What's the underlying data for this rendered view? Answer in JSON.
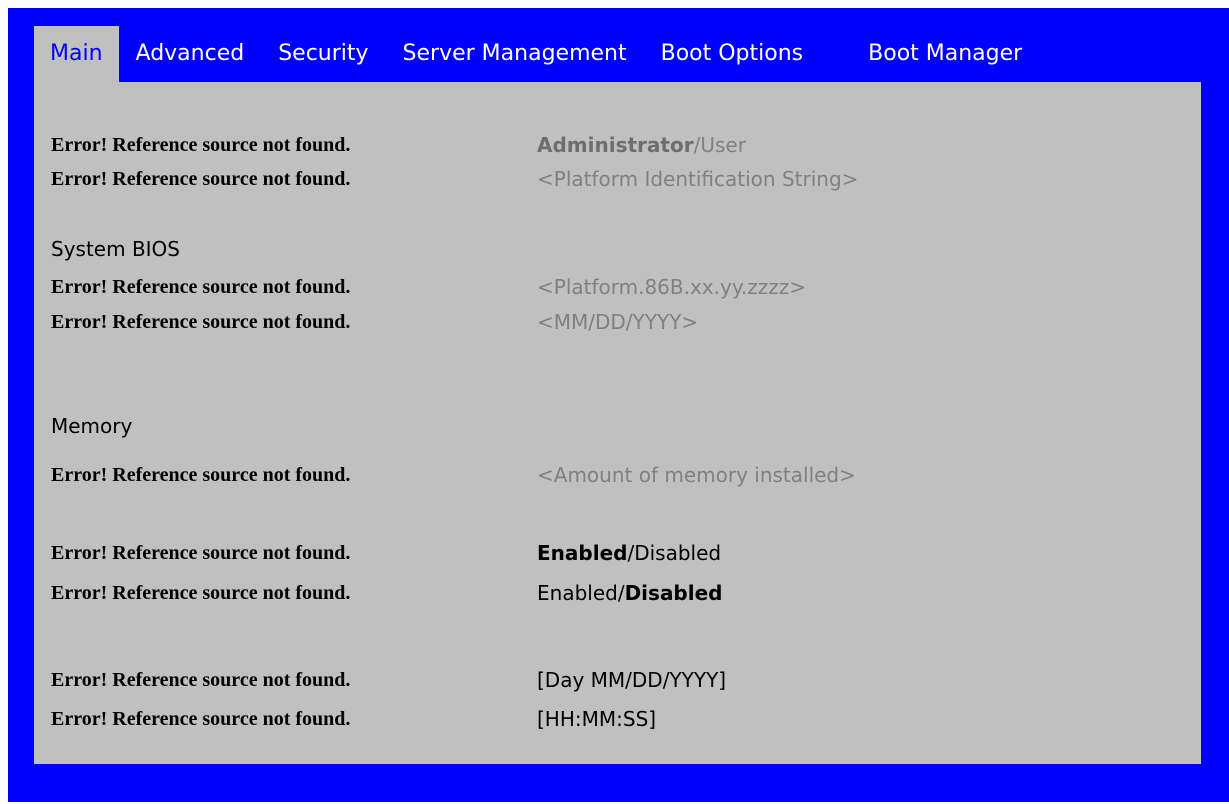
{
  "tabs": [
    {
      "label": "Main",
      "active": true
    },
    {
      "label": "Advanced",
      "active": false
    },
    {
      "label": "Security",
      "active": false
    },
    {
      "label": "Server Management",
      "active": false
    },
    {
      "label": "Boot Options",
      "active": false
    },
    {
      "label": "Boot Manager",
      "active": false
    }
  ],
  "colors": {
    "background": "#0000ff",
    "panel": "#c0c0c0",
    "active_tab_text": "#0000ff",
    "tab_text": "#ffffff",
    "readonly_value": "#808080"
  },
  "error_label": "Error! Reference source not found.",
  "rows": {
    "access_level": {
      "label": "Error! Reference source not found.",
      "value_selected": "Administrator",
      "value_separator": "/",
      "value_other": "User"
    },
    "platform_id": {
      "label": "Error! Reference source not found.",
      "value": "<Platform Identification String>"
    },
    "bios_version": {
      "label": "Error! Reference source not found.",
      "value": "<Platform.86B.xx.yy.zzzz>"
    },
    "bios_build_date": {
      "label": "Error! Reference source not found.",
      "value": "<MM/DD/YYYY>"
    },
    "total_memory": {
      "label": "Error! Reference source not found.",
      "value": "<Amount of memory installed>"
    },
    "quiet_boot": {
      "label": "Error! Reference source not found.",
      "option_a": "Enabled",
      "separator": "/",
      "option_b": "Disabled",
      "selected": "Enabled"
    },
    "post_error_pause": {
      "label": "Error! Reference source not found.",
      "option_a": "Enabled",
      "separator": "/",
      "option_b": "Disabled",
      "selected": "Disabled"
    },
    "system_date": {
      "label": "Error! Reference source not found.",
      "value": "[Day MM/DD/YYYY]"
    },
    "system_time": {
      "label": "Error! Reference source not found.",
      "value": "[HH:MM:SS]"
    }
  },
  "sections": {
    "system_bios": "System BIOS",
    "memory": "Memory"
  }
}
